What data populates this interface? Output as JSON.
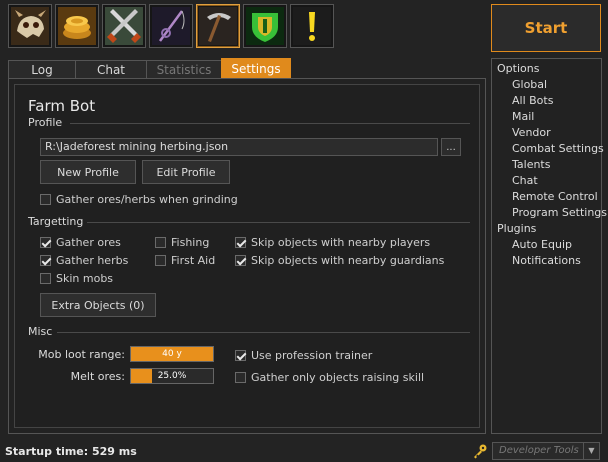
{
  "toolbar": {
    "icons": [
      {
        "name": "dragon-skull-icon"
      },
      {
        "name": "gold-coins-icon"
      },
      {
        "name": "crossed-swords-icon"
      },
      {
        "name": "fishing-rod-icon"
      },
      {
        "name": "pickaxe-icon"
      },
      {
        "name": "green-shield-icon"
      },
      {
        "name": "exclamation-quest-icon"
      }
    ],
    "active_index": 4
  },
  "start_button": {
    "label": "Start",
    "color": "#e08a1c"
  },
  "tabs": [
    {
      "label": "Log"
    },
    {
      "label": "Chat"
    },
    {
      "label": "Statistics",
      "disabled": true
    },
    {
      "label": "Settings",
      "active": true
    }
  ],
  "settings": {
    "title": "Farm Bot",
    "profile": {
      "group_title": "Profile",
      "path": "R:\\Jadeforest mining herbing.json",
      "browse_label": "...",
      "new_profile_label": "New Profile",
      "edit_profile_label": "Edit Profile",
      "gather_while_grinding": {
        "label": "Gather ores/herbs when grinding",
        "checked": false
      }
    },
    "targetting": {
      "group_title": "Targetting",
      "gather_ores": {
        "label": "Gather ores",
        "checked": true
      },
      "gather_herbs": {
        "label": "Gather herbs",
        "checked": true
      },
      "skin_mobs": {
        "label": "Skin mobs",
        "checked": false
      },
      "fishing": {
        "label": "Fishing",
        "checked": false
      },
      "first_aid": {
        "label": "First Aid",
        "checked": false
      },
      "skip_nearby_players": {
        "label": "Skip objects with nearby players",
        "checked": true
      },
      "skip_nearby_guardians": {
        "label": "Skip objects with nearby guardians",
        "checked": true
      },
      "extra_objects_label": "Extra Objects (0)"
    },
    "misc": {
      "group_title": "Misc",
      "mob_loot_range": {
        "label": "Mob loot range:",
        "value_text": "40 y",
        "fraction": 1.0
      },
      "melt_ores": {
        "label": "Melt ores:",
        "value_text": "25.0%",
        "fraction": 0.25
      },
      "use_profession_trainer": {
        "label": "Use profession trainer",
        "checked": true
      },
      "gather_only_raising_skill": {
        "label": "Gather only objects raising skill",
        "checked": false
      }
    }
  },
  "options_tree": {
    "items": [
      {
        "label": "Options",
        "level": 0
      },
      {
        "label": "Global",
        "level": 1
      },
      {
        "label": "All Bots",
        "level": 1
      },
      {
        "label": "Mail",
        "level": 1
      },
      {
        "label": "Vendor",
        "level": 1
      },
      {
        "label": "Combat Settings",
        "level": 1
      },
      {
        "label": "Talents",
        "level": 1
      },
      {
        "label": "Chat",
        "level": 1
      },
      {
        "label": "Remote Control",
        "level": 1
      },
      {
        "label": "Program Settings",
        "level": 1
      },
      {
        "label": "Plugins",
        "level": 0
      },
      {
        "label": "Auto Equip",
        "level": 1
      },
      {
        "label": "Notifications",
        "level": 1
      }
    ]
  },
  "status": {
    "startup_text": "Startup time: 529 ms"
  },
  "developer_tools": {
    "placeholder": "Developer Tools"
  }
}
